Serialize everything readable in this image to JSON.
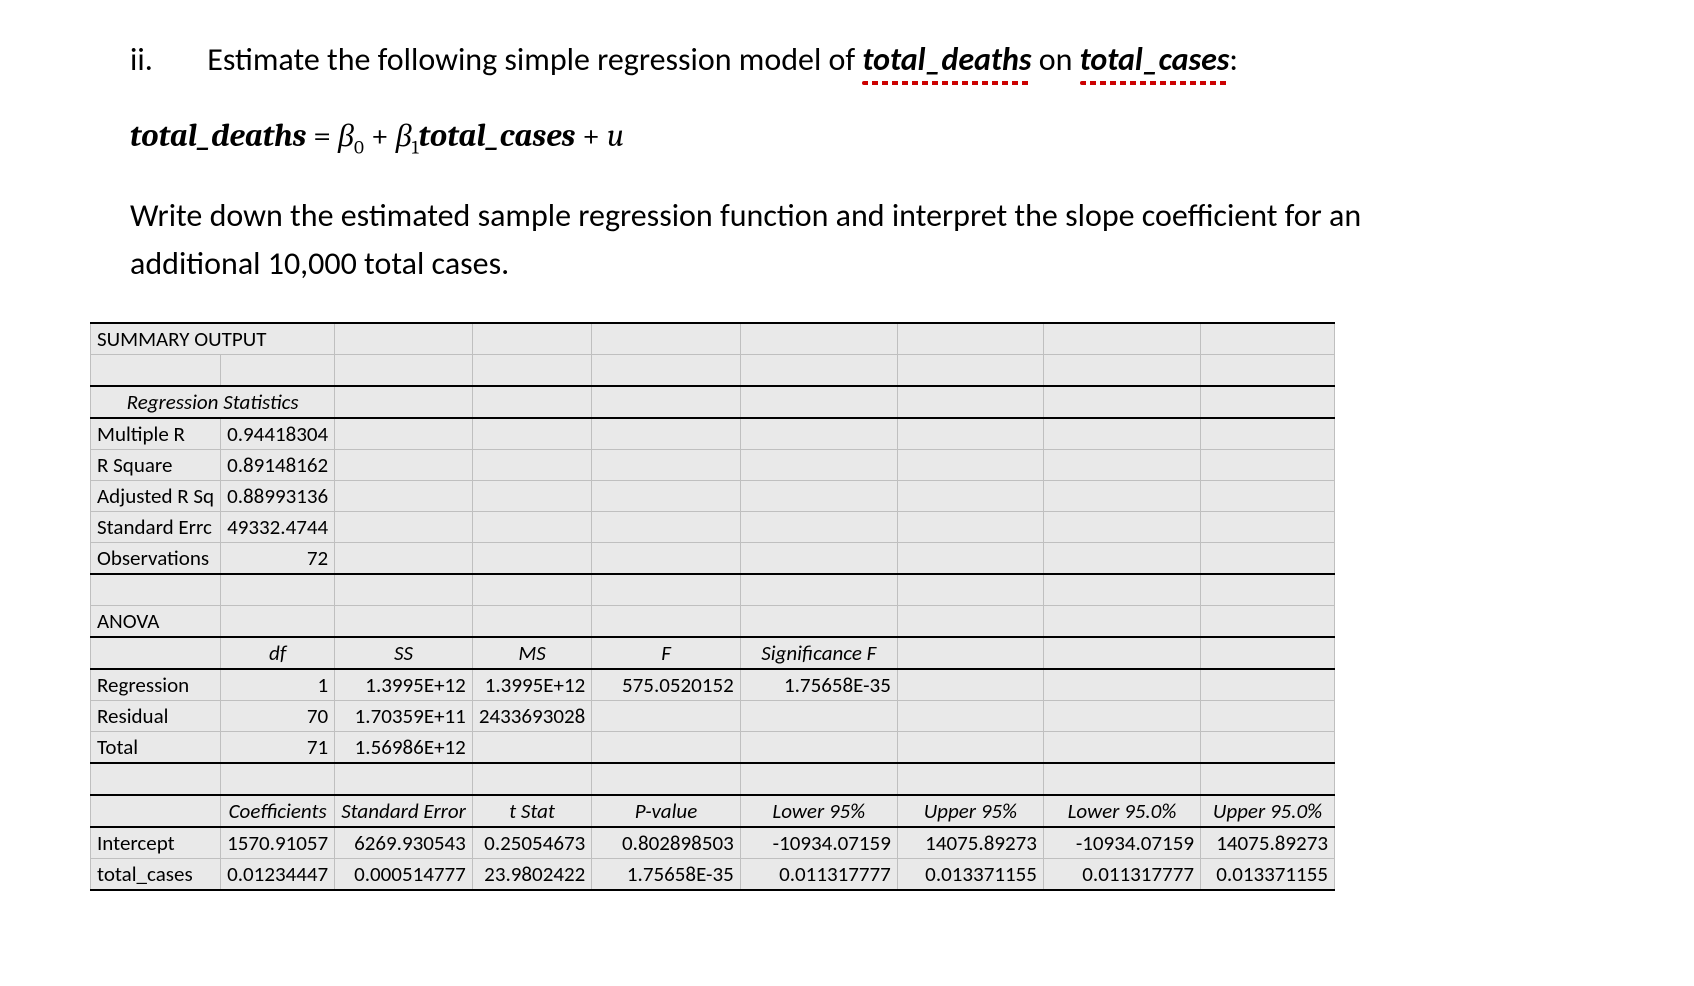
{
  "question": {
    "marker": "ii.",
    "lead": "Estimate the following simple regression model of ",
    "var1": "total_deaths",
    "mid": " on ",
    "var2": "total_cases",
    "end": ":"
  },
  "equation": {
    "lhs": "total_deaths",
    "eq": " = ",
    "b0": "β",
    "sub0": "0",
    "plus1": " + ",
    "b1": "β",
    "sub1": "1",
    "rhs": "total_cases",
    "plus2": " + ",
    "u": "u"
  },
  "instruction": "Write down the estimated sample regression function and interpret the slope coefficient for an additional 10,000 total cases.",
  "sheet": {
    "summary_title": "SUMMARY OUTPUT",
    "regstats_title": "Regression Statistics",
    "stats": {
      "multiple_r": {
        "label": "Multiple R",
        "value": "0.94418304"
      },
      "r_square": {
        "label": "R Square",
        "value": "0.89148162"
      },
      "adj_r_sq": {
        "label": "Adjusted R Sq",
        "value": "0.88993136"
      },
      "std_err": {
        "label": "Standard Errc",
        "value": "49332.4744"
      },
      "obs": {
        "label": "Observations",
        "value": "72"
      }
    },
    "anova_title": "ANOVA",
    "anova_headers": {
      "df": "df",
      "ss": "SS",
      "ms": "MS",
      "f": "F",
      "sigf": "Significance F"
    },
    "anova": {
      "regression": {
        "label": "Regression",
        "df": "1",
        "ss": "1.3995E+12",
        "ms": "1.3995E+12",
        "f": "575.0520152",
        "sigf": "1.75658E-35"
      },
      "residual": {
        "label": "Residual",
        "df": "70",
        "ss": "1.70359E+11",
        "ms": "2433693028",
        "f": "",
        "sigf": ""
      },
      "total": {
        "label": "Total",
        "df": "71",
        "ss": "1.56986E+12",
        "ms": "",
        "f": "",
        "sigf": ""
      }
    },
    "coef_headers": {
      "coef": "Coefficients",
      "se": "Standard Error",
      "t": "t Stat",
      "p": "P-value",
      "l95": "Lower 95%",
      "u95": "Upper 95%",
      "l950": "Lower 95.0%",
      "u950": "Upper 95.0%"
    },
    "coefs": {
      "intercept": {
        "label": "Intercept",
        "coef": "1570.91057",
        "se": "6269.930543",
        "t": "0.25054673",
        "p": "0.802898503",
        "l95": "-10934.07159",
        "u95": "14075.89273",
        "l950": "-10934.07159",
        "u950": "14075.89273"
      },
      "total_cases": {
        "label": "total_cases",
        "coef": "0.01234447",
        "se": "0.000514777",
        "t": "23.9802422",
        "p": "1.75658E-35",
        "l95": "0.011317777",
        "u95": "0.013371155",
        "l950": "0.011317777",
        "u950": "0.013371155"
      }
    }
  }
}
